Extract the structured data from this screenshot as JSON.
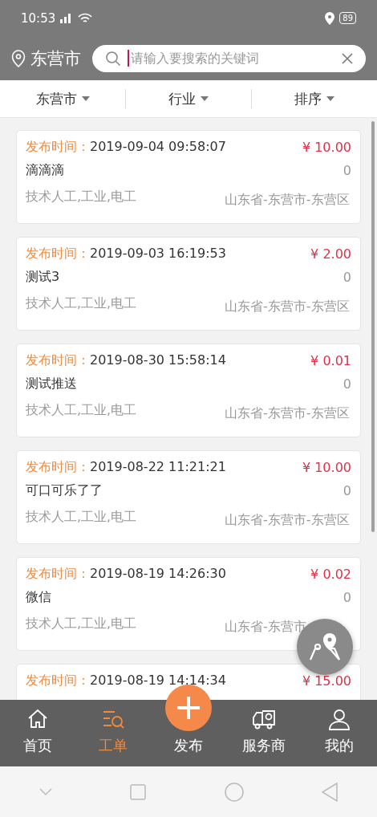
{
  "status_bar": {
    "time": "10:53",
    "battery": "89"
  },
  "header": {
    "city": "东营市",
    "search": {
      "placeholder": "请输入要搜索的关键词"
    }
  },
  "filters": [
    {
      "label": "东营市"
    },
    {
      "label": "行业"
    },
    {
      "label": "排序"
    }
  ],
  "orders": [
    {
      "time_label": "发布时间：",
      "time": "2019-09-04 09:58:07",
      "price": "¥ 10.00",
      "title": "滴滴滴",
      "count": "0",
      "tags": "技术人工,工业,电工",
      "region": "山东省-东营市-东营区"
    },
    {
      "time_label": "发布时间：",
      "time": "2019-09-03 16:19:53",
      "price": "¥ 2.00",
      "title": "测试3",
      "count": "0",
      "tags": "技术人工,工业,电工",
      "region": "山东省-东营市-东营区"
    },
    {
      "time_label": "发布时间：",
      "time": "2019-08-30 15:58:14",
      "price": "¥ 0.01",
      "title": "测试推送",
      "count": "0",
      "tags": "技术人工,工业,电工",
      "region": "山东省-东营市-东营区"
    },
    {
      "time_label": "发布时间：",
      "time": "2019-08-22 11:21:21",
      "price": "¥ 10.00",
      "title": "可口可乐了了",
      "count": "0",
      "tags": "技术人工,工业,电工",
      "region": "山东省-东营市-东营区"
    },
    {
      "time_label": "发布时间：",
      "time": "2019-08-19 14:26:30",
      "price": "¥ 0.02",
      "title": "微信",
      "count": "0",
      "tags": "技术人工,工业,电工",
      "region": "山东省-东营市"
    },
    {
      "time_label": "发布时间：",
      "time": "2019-08-19 14:14:34",
      "price": "¥ 15.00"
    }
  ],
  "tab_bar": [
    {
      "kind": "home",
      "label": "首页",
      "selected": false
    },
    {
      "kind": "orders",
      "label": "工单",
      "selected": true
    },
    {
      "kind": "publish",
      "label": "发布",
      "selected": false
    },
    {
      "kind": "providers",
      "label": "服务商",
      "selected": false
    },
    {
      "kind": "profile",
      "label": "我的",
      "selected": false
    }
  ]
}
